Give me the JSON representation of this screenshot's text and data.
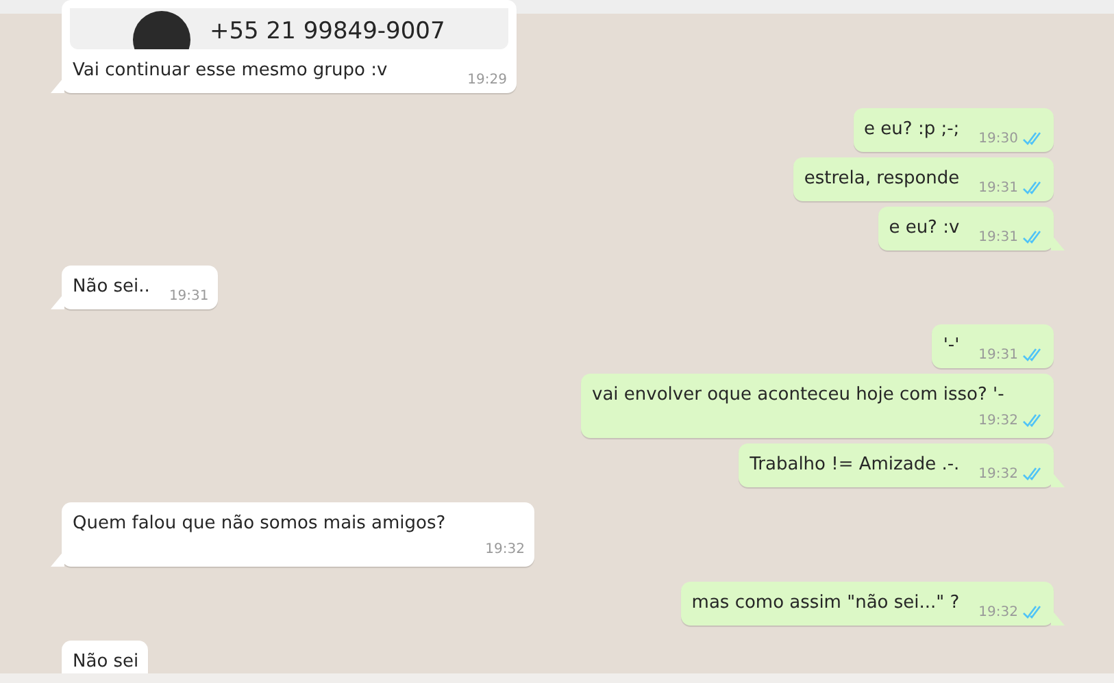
{
  "messages": [
    {
      "kind": "incoming",
      "card": {
        "phone": "+55 21 99849-9007"
      },
      "text": "Vai continuar esse mesmo grupo :v",
      "time": "19:29",
      "tail": true
    },
    {
      "kind": "outgoing",
      "text": "e eu? :p ;-;",
      "time": "19:30",
      "read": true,
      "tail": false
    },
    {
      "kind": "outgoing",
      "text": "estrela, responde",
      "time": "19:31",
      "read": true,
      "tail": false
    },
    {
      "kind": "outgoing",
      "text": "e eu? :v",
      "time": "19:31",
      "read": true,
      "tail": true
    },
    {
      "kind": "incoming",
      "text": "Não sei..",
      "time": "19:31",
      "tail": true
    },
    {
      "kind": "outgoing",
      "text": "'-'",
      "time": "19:31",
      "read": true,
      "tail": false
    },
    {
      "kind": "outgoing",
      "text": "vai envolver oque aconteceu hoje com isso? '-",
      "time": "19:32",
      "read": true,
      "tail": false,
      "wrap_time": true
    },
    {
      "kind": "outgoing",
      "text": "Trabalho != Amizade .-.",
      "time": "19:32",
      "read": true,
      "tail": true
    },
    {
      "kind": "incoming",
      "text": "Quem falou que não somos mais amigos?",
      "time": "19:32",
      "tail": true,
      "wrap_time": true
    },
    {
      "kind": "outgoing",
      "text": "mas como assim \"não sei...\" ?",
      "time": "19:32",
      "read": true,
      "tail": true
    },
    {
      "kind": "incoming",
      "text": "Não sei",
      "tail": false
    }
  ]
}
